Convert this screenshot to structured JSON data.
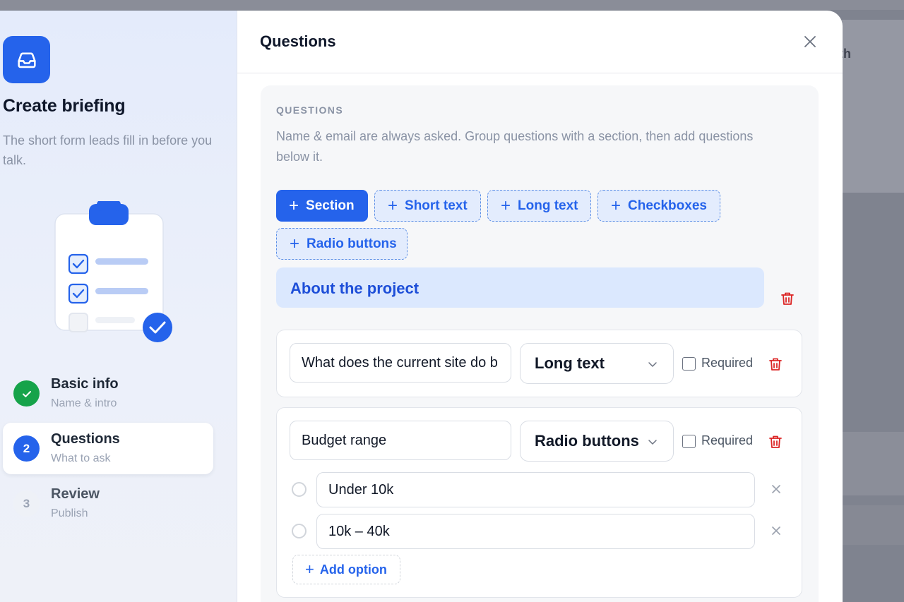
{
  "backdrop": {
    "partial_text": "th"
  },
  "sidebar": {
    "title": "Create briefing",
    "subtitle": "The short form leads fill in before you talk.",
    "steps": [
      {
        "number": "",
        "title": "Basic info",
        "subtitle": "Name & intro",
        "state": "done"
      },
      {
        "number": "2",
        "title": "Questions",
        "subtitle": "What to ask",
        "state": "current"
      },
      {
        "number": "3",
        "title": "Review",
        "subtitle": "Publish",
        "state": "todo"
      }
    ]
  },
  "header": {
    "title": "Questions"
  },
  "panel": {
    "label": "QUESTIONS",
    "description": "Name & email are always asked. Group questions with a section, then add questions below it.",
    "add_buttons": [
      {
        "label": "Section",
        "style": "primary"
      },
      {
        "label": "Short text",
        "style": "dashed"
      },
      {
        "label": "Long text",
        "style": "dashed"
      },
      {
        "label": "Checkboxes",
        "style": "dashed"
      },
      {
        "label": "Radio buttons",
        "style": "dashed"
      }
    ],
    "section": {
      "title": "About the project"
    },
    "questions": [
      {
        "text": "What does the current site do b",
        "type": "Long text",
        "required_label": "Required",
        "required": false
      },
      {
        "text": "Budget range",
        "type": "Radio buttons",
        "required_label": "Required",
        "required": false,
        "options": [
          "Under 10k",
          "10k – 40k"
        ],
        "add_option_label": "Add option"
      }
    ]
  },
  "colors": {
    "accent": "#2563eb",
    "success": "#16a34a",
    "danger": "#dc2626",
    "section_bg": "#dbe8fe"
  }
}
